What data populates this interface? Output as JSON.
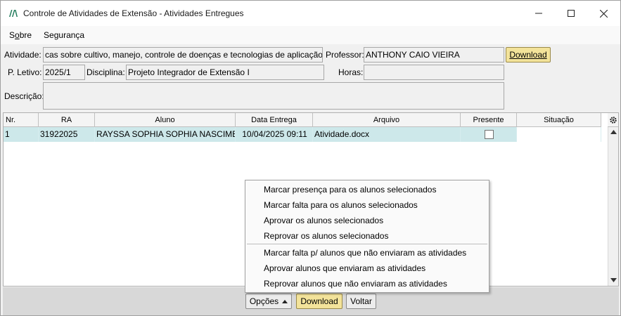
{
  "window": {
    "title": "Controle de Atividades de Extensão - Atividades Entregues",
    "controls": [
      "minimize-icon",
      "maximize-icon",
      "close-icon"
    ]
  },
  "menu": {
    "items": [
      {
        "label": "Sobre",
        "mnemonic": "o"
      },
      {
        "label": "Segurança"
      }
    ]
  },
  "form": {
    "atividade_label": "Atividade:",
    "atividade_value": "cas sobre cultivo, manejo, controle de doenças e tecnologias de aplicação.",
    "professor_label": "Professor:",
    "professor_value": "ANTHONY CAIO VIEIRA",
    "download_label": "Download",
    "periodo_label": "P. Letivo:",
    "periodo_value": "2025/1",
    "disciplina_label": "Disciplina:",
    "disciplina_value": "Projeto Integrador de Extensão I",
    "horas_label": "Horas:",
    "horas_value": "",
    "descricao_label": "Descrição:",
    "descricao_value": ""
  },
  "grid": {
    "columns": [
      "Nr.",
      "RA",
      "Aluno",
      "Data Entrega",
      "Arquivo",
      "Presente",
      "Situação"
    ],
    "rows": [
      {
        "nr": "1",
        "ra": "31922025",
        "aluno": "RAYSSA SOPHIA SOPHIA NASCIME...",
        "data_entrega": "10/04/2025 09:11",
        "arquivo": "Atividade.docx",
        "presente": false,
        "situacao": ""
      }
    ],
    "settings_icon": "gear-icon"
  },
  "context_menu": {
    "group1": [
      "Marcar presença para os alunos selecionados",
      "Marcar falta para os alunos selecionados",
      "Aprovar os alunos selecionados",
      "Reprovar os alunos selecionados"
    ],
    "group2": [
      "Marcar falta p/ alunos que não enviaram as atividades",
      "Aprovar alunos que enviaram as atividades",
      "Reprovar alunos que não enviaram as atividades"
    ]
  },
  "bottom": {
    "opcoes_label": "Opções",
    "download_label": "Download",
    "voltar_label": "Voltar"
  },
  "colors": {
    "selected_row": "#cde8ea",
    "download_button": "#f3e39a",
    "bottom_bar": "#d8d8d8"
  }
}
